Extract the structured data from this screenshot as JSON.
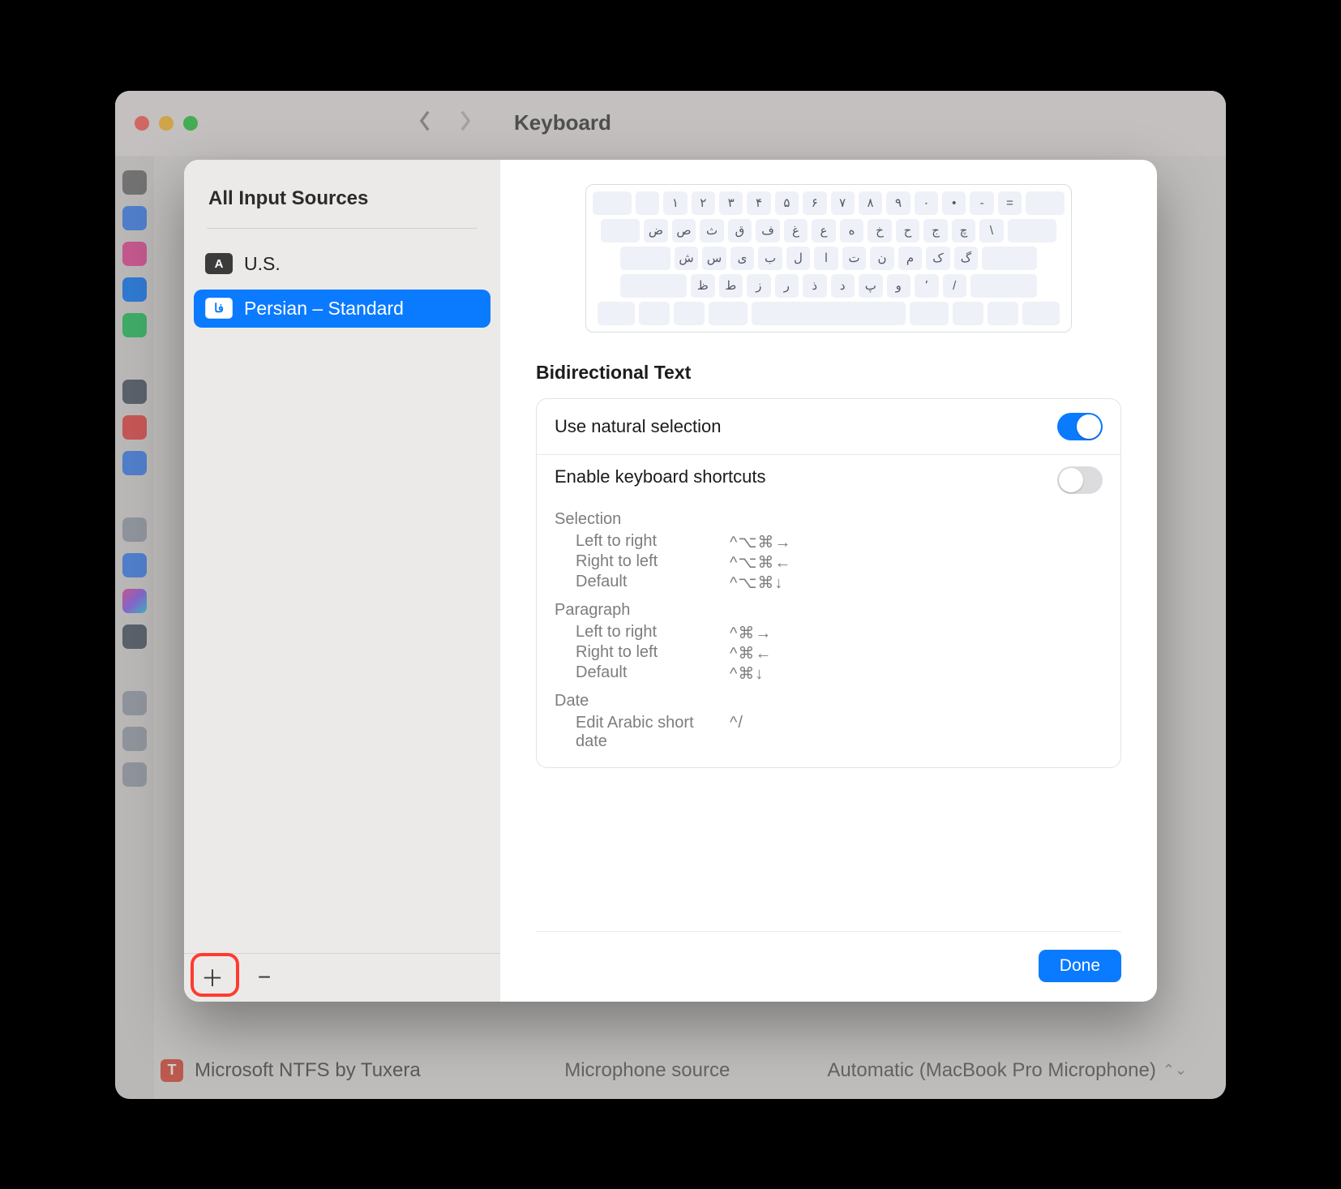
{
  "window": {
    "title": "Keyboard",
    "bg_item_label": "Microsoft NTFS by Tuxera",
    "mic_label": "Microphone source",
    "mic_value": "Automatic (MacBook Pro Microphone)"
  },
  "sheet": {
    "sidebar_title": "All Input Sources",
    "sources": [
      {
        "badge": "A",
        "label": "U.S.",
        "selected": false
      },
      {
        "badge": "فا",
        "label": "Persian – Standard",
        "selected": true
      }
    ]
  },
  "keyboard_rows": [
    [
      "",
      "۱",
      "۲",
      "۳",
      "۴",
      "۵",
      "۶",
      "۷",
      "۸",
      "۹",
      "۰",
      "•",
      "-",
      "="
    ],
    [
      "ض",
      "ص",
      "ث",
      "ق",
      "ف",
      "غ",
      "ع",
      "ه",
      "خ",
      "ح",
      "ج",
      "چ",
      "\\"
    ],
    [
      "ش",
      "س",
      "ی",
      "ب",
      "ل",
      "ا",
      "ت",
      "ن",
      "م",
      "ک",
      "گ"
    ],
    [
      "ظ",
      "ط",
      "ز",
      "ر",
      "ذ",
      "د",
      "پ",
      "و",
      "٬",
      "/"
    ]
  ],
  "bidi": {
    "section_title": "Bidirectional Text",
    "use_natural_label": "Use natural selection",
    "use_natural_on": true,
    "shortcuts_label": "Enable keyboard shortcuts",
    "shortcuts_on": false,
    "groups": [
      {
        "title": "Selection",
        "rows": [
          {
            "label": "Left to right",
            "keys": "^⌥⌘→"
          },
          {
            "label": "Right to left",
            "keys": "^⌥⌘←"
          },
          {
            "label": "Default",
            "keys": "^⌥⌘↓"
          }
        ]
      },
      {
        "title": "Paragraph",
        "rows": [
          {
            "label": "Left to right",
            "keys": "^⌘→"
          },
          {
            "label": "Right to left",
            "keys": "^⌘←"
          },
          {
            "label": "Default",
            "keys": "^⌘↓"
          }
        ]
      },
      {
        "title": "Date",
        "rows": [
          {
            "label": "Edit Arabic short date",
            "keys": "^/"
          }
        ]
      }
    ]
  },
  "done_label": "Done"
}
